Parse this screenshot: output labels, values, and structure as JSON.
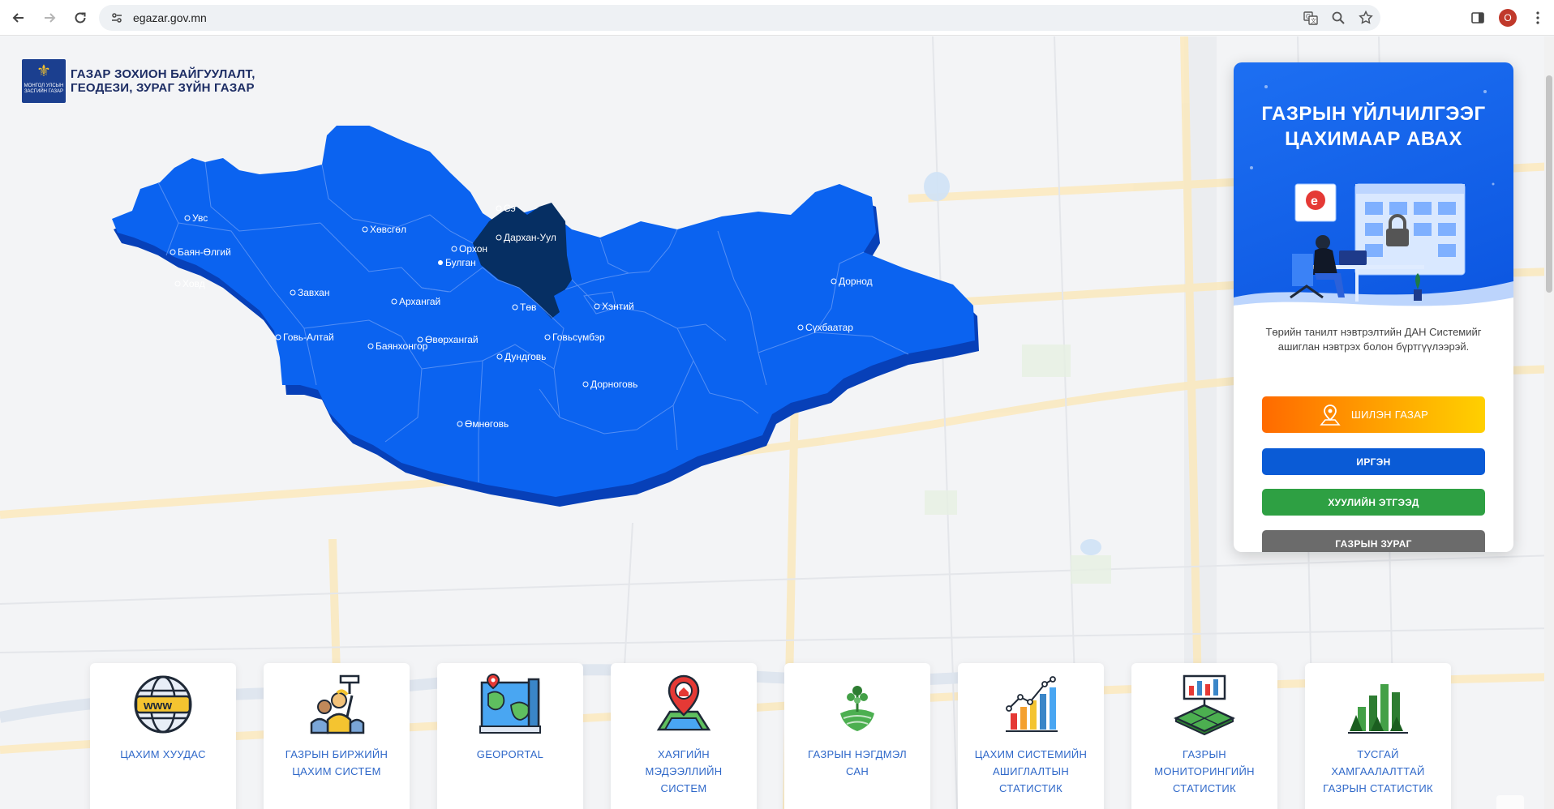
{
  "browser": {
    "url": "egazar.gov.mn",
    "back_icon": "arrow-left-icon",
    "forward_icon": "arrow-right-icon",
    "reload_icon": "reload-icon",
    "profile_initial": "O"
  },
  "header": {
    "org_name_line1": "ГАЗАР ЗОХИОН БАЙГУУЛАЛТ,",
    "org_name_line2": "ГЕОДЕЗИ, ЗУРАГ ЗҮЙН ГАЗАР"
  },
  "map": {
    "provinces": [
      {
        "name": "Увс"
      },
      {
        "name": "Баян-Өлгий"
      },
      {
        "name": "Ховд"
      },
      {
        "name": "Хөвсгөл"
      },
      {
        "name": "Завхан"
      },
      {
        "name": "Говь-Алтай"
      },
      {
        "name": "Архангай"
      },
      {
        "name": "Баянхонгор"
      },
      {
        "name": "Өвөрхангай"
      },
      {
        "name": "Орхон"
      },
      {
        "name": "Булган"
      },
      {
        "name": "Сэ"
      },
      {
        "name": "Дархан-Уул"
      },
      {
        "name": "Төв"
      },
      {
        "name": "Дундговь"
      },
      {
        "name": "Өмнөговь"
      },
      {
        "name": "Говьсүмбэр"
      },
      {
        "name": "Дорноговь"
      },
      {
        "name": "Хэнтий"
      },
      {
        "name": "Сүхбаатар"
      },
      {
        "name": "Дорнод"
      }
    ],
    "highlighted": "Булган",
    "colors": {
      "province": "#0b63f0",
      "shadow": "#0740b8",
      "highlight": "#062f63"
    }
  },
  "panel": {
    "title_line1": "ГАЗРЫН ҮЙЛЧИЛГЭЭГ",
    "title_line2": "ЦАХИМААР АВАХ",
    "description": "Төрийн танилт нэвтрэлтийн ДАН Системийг ашиглан нэвтрэх болон бүртгүүлээрэй.",
    "buttons": [
      {
        "label": "ШИЛЭН ГАЗАР",
        "color": "#ff8c00"
      },
      {
        "label": "ИРГЭН",
        "color": "#0a5bd6"
      },
      {
        "label": "ХУУЛИЙН ЭТГЭЭД",
        "color": "#2ea043"
      },
      {
        "label": "ГАЗРЫН ЗУРАГ",
        "color": "#6b6b6b"
      }
    ]
  },
  "cards": [
    {
      "label": "ЦАХИМ ХУУДАС",
      "icon": "www-globe-icon"
    },
    {
      "label": "ГАЗРЫН БИРЖИЙН ЦАХИМ СИСТЕМ",
      "icon": "auction-person-icon"
    },
    {
      "label": "GEOPORTAL",
      "icon": "map-icon"
    },
    {
      "label": "ХАЯГИЙН МЭДЭЭЛЛИЙН СИСТЕМ",
      "icon": "location-pin-icon"
    },
    {
      "label": "ГАЗРЫН НЭГДМЭЛ САН",
      "icon": "land-plant-icon"
    },
    {
      "label": "ЦАХИМ СИСТЕМИЙН АШИГЛАЛТЫН СТАТИСТИК",
      "icon": "growth-chart-icon"
    },
    {
      "label": "ГАЗРЫН МОНИТОРИНГИЙН СТАТИСТИК",
      "icon": "monitoring-land-icon"
    },
    {
      "label": "ТУСГАЙ ХАМГААЛАЛТТАЙ ГАЗРЫН СТАТИСТИК",
      "icon": "forest-stats-icon"
    }
  ]
}
